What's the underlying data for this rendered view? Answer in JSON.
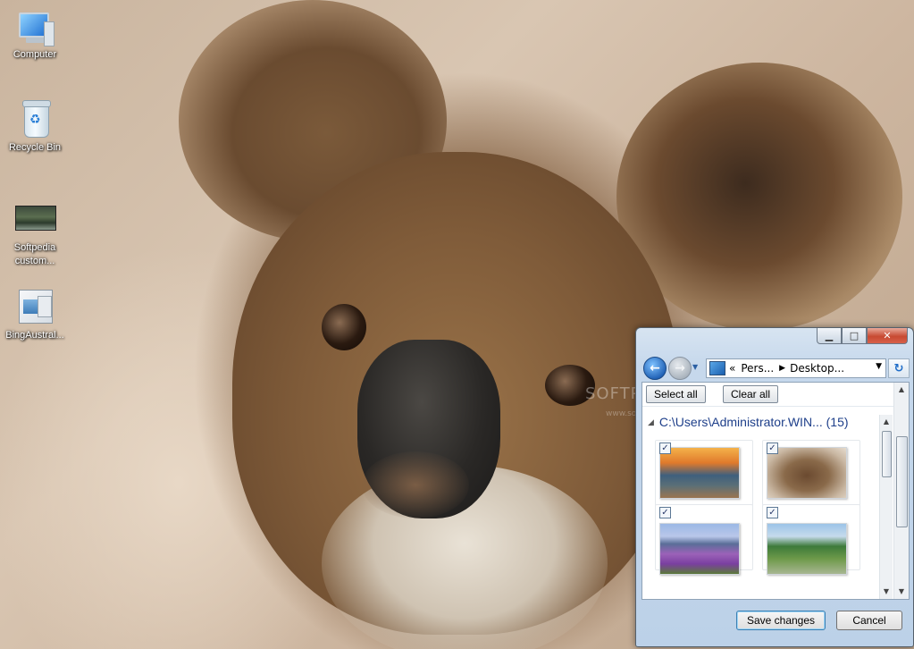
{
  "desktop": {
    "icons": [
      {
        "label": "Computer",
        "icon": "computer-icon"
      },
      {
        "label": "Recycle Bin",
        "icon": "recycle-bin-icon"
      },
      {
        "label_line1": "Softpedia",
        "label_line2": "custom...",
        "icon": "image-file-icon"
      },
      {
        "label": "BingAustral...",
        "icon": "theme-file-icon"
      }
    ],
    "watermark": "SOFTPEDIA",
    "watermark_url": "www.softpedia.com"
  },
  "window": {
    "caption_buttons": {
      "minimize": "▁",
      "maximize": "□",
      "close": "✕"
    },
    "nav": {
      "back": "←",
      "forward": "→",
      "address_prefix": "«",
      "address_segments": [
        "Pers...",
        "Desktop..."
      ],
      "refresh": "↻"
    },
    "toolbar": {
      "select_all": "Select all",
      "clear_all": "Clear all"
    },
    "group": {
      "path": "C:\\Users\\Administrator.WIN...",
      "count": "(15)"
    },
    "thumbnails": [
      {
        "name": "twelve-apostles",
        "checked": true
      },
      {
        "name": "koala",
        "checked": true
      },
      {
        "name": "lavender-field",
        "checked": true
      },
      {
        "name": "island-buildings",
        "checked": true
      }
    ],
    "footer": {
      "save": "Save changes",
      "cancel": "Cancel"
    }
  }
}
